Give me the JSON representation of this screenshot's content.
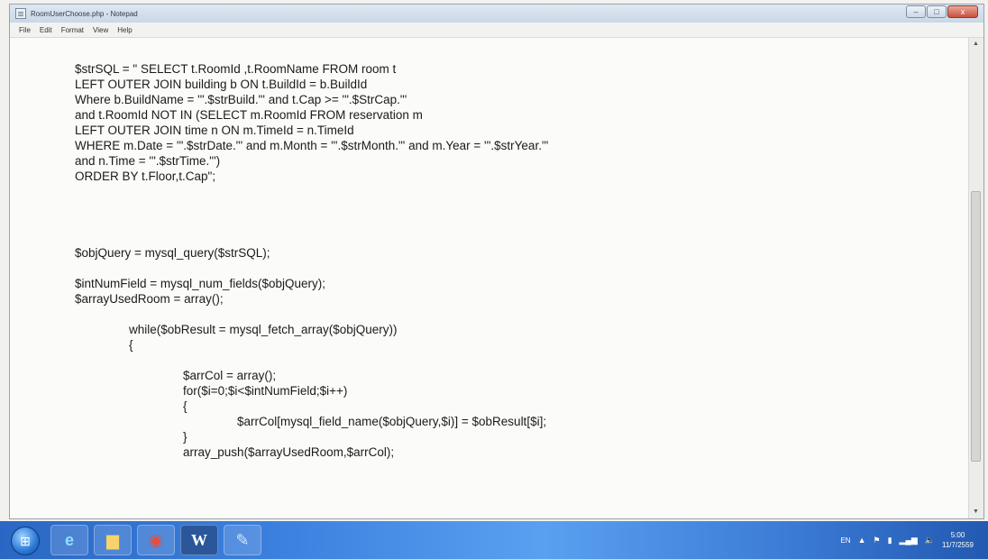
{
  "window": {
    "title": "RoomUserChoose.php - Notepad",
    "buttons": {
      "minimize": "–",
      "maximize": "□",
      "close": "x"
    }
  },
  "menu": [
    "File",
    "Edit",
    "Format",
    "View",
    "Help"
  ],
  "code_lines": [
    "$strSQL = \" SELECT t.RoomId ,t.RoomName FROM room t",
    "LEFT OUTER JOIN building b ON t.BuildId = b.BuildId",
    "Where b.BuildName = '\".$strBuild.\"' and t.Cap >= '\".$StrCap.\"'",
    "and t.RoomId NOT IN (SELECT m.RoomId FROM reservation m",
    "LEFT OUTER JOIN time n ON m.TimeId = n.TimeId",
    "WHERE m.Date = '\".$strDate.\"' and m.Month = '\".$strMonth.\"' and m.Year = '\".$strYear.\"'",
    "and n.Time = '\".$strTime.\"')",
    "ORDER BY t.Floor,t.Cap\";",
    "",
    "",
    "",
    "",
    "$objQuery = mysql_query($strSQL);",
    "",
    "$intNumField = mysql_num_fields($objQuery);",
    "$arrayUsedRoom = array();",
    "",
    "                while($obResult = mysql_fetch_array($objQuery))",
    "                {",
    "",
    "                                $arrCol = array();",
    "                                for($i=0;$i<$intNumField;$i++)",
    "                                {",
    "                                                $arrCol[mysql_field_name($objQuery,$i)] = $obResult[$i];",
    "                                }",
    "                                array_push($arrayUsedRoom,$arrCol);"
  ],
  "taskbar": {
    "items": [
      {
        "name": "internet-explorer",
        "glyph": "e"
      },
      {
        "name": "file-explorer",
        "glyph": "▆"
      },
      {
        "name": "chrome",
        "glyph": "◉"
      },
      {
        "name": "word",
        "glyph": "W"
      },
      {
        "name": "notepad",
        "glyph": "✎"
      }
    ],
    "tray": {
      "language": "EN",
      "time": "5:00",
      "date": "11/7/2559"
    }
  }
}
